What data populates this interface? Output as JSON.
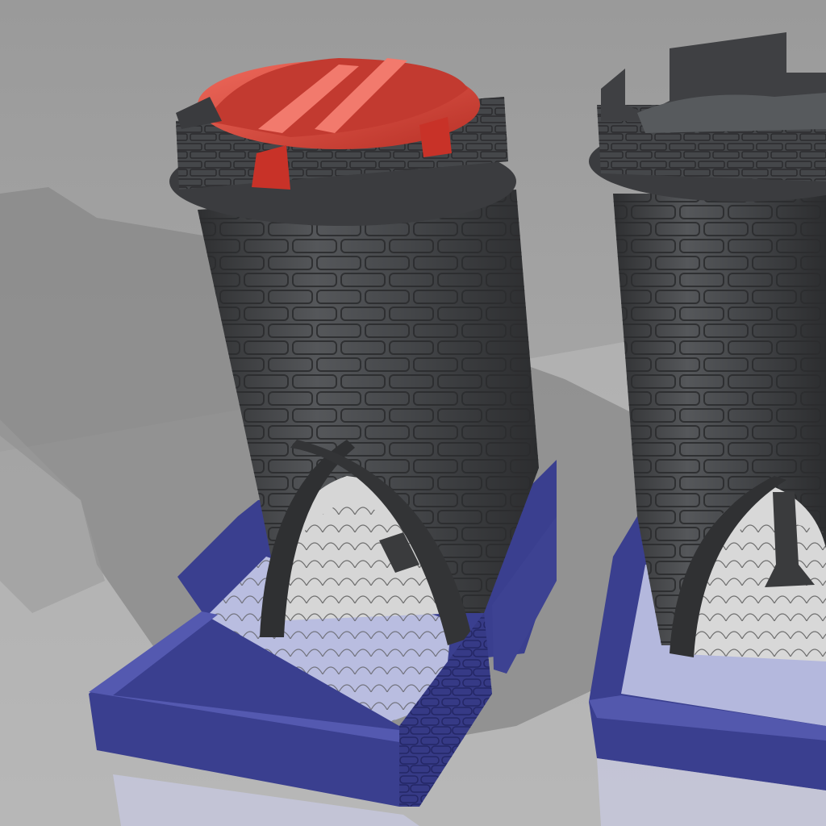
{
  "scene": {
    "kind": "3d-render",
    "subject": "dice-tower",
    "models": [
      {
        "id": "left-tower",
        "lid": "red-divided-insert",
        "body": "dark-grey-brick-cylinder",
        "tray": "blue-square-tray"
      },
      {
        "id": "right-tower",
        "lid": "crenellated-battlements",
        "body": "dark-grey-brick-cylinder",
        "tray": "blue-square-tray"
      }
    ]
  },
  "colors": {
    "background": "#a3a3a3",
    "floor": "#bdbdbd",
    "shadow": "#8e8e8e",
    "tower_grey": "#4a4b4d",
    "tower_dark": "#2f3032",
    "tower_light": "#6a6b6e",
    "insert_red": "#d9453a",
    "insert_red_dark": "#a52a22",
    "tray_blue": "#3a3f8f",
    "tray_blue_light": "#5459b0",
    "tray_floor": "#b9bde0",
    "arch_floor": "#d2d2d2"
  }
}
